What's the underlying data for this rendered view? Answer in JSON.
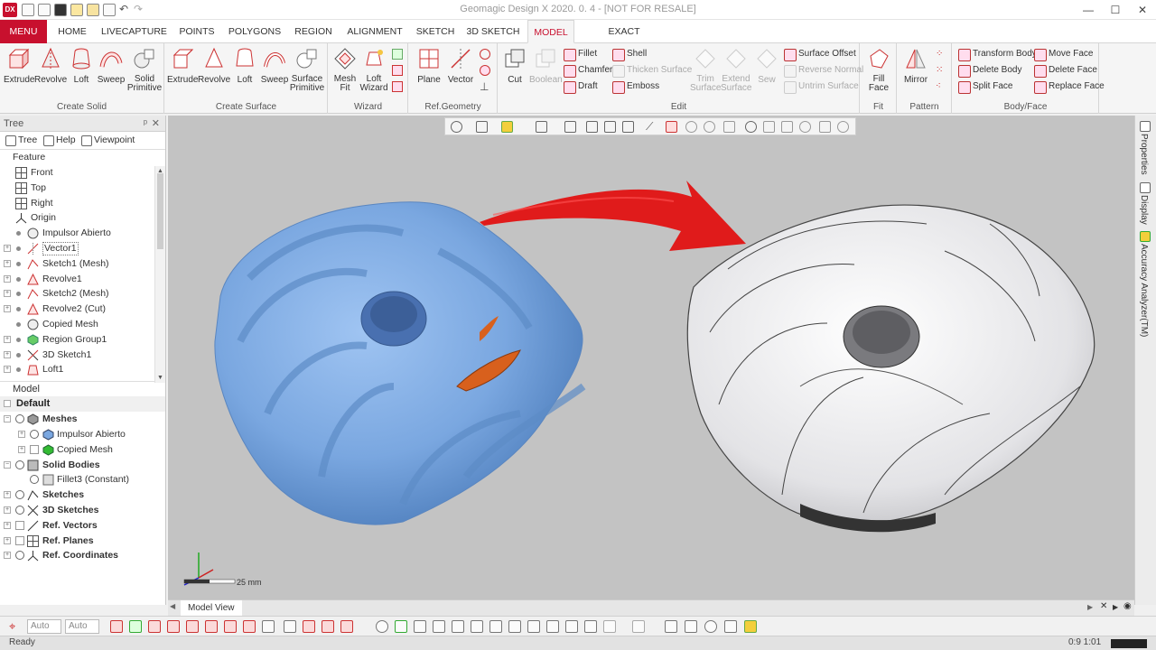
{
  "window": {
    "logo": "DX",
    "title": "Geomagic Design X 2020. 0. 4 - [NOT FOR RESALE]",
    "minimize": "—",
    "maximize": "☐",
    "close": "✕"
  },
  "tabs": [
    {
      "label": "MENU"
    },
    {
      "label": "HOME"
    },
    {
      "label": "LIVECAPTURE"
    },
    {
      "label": "POINTS"
    },
    {
      "label": "POLYGONS"
    },
    {
      "label": "REGION"
    },
    {
      "label": "ALIGNMENT"
    },
    {
      "label": "SKETCH"
    },
    {
      "label": "3D SKETCH"
    },
    {
      "label": "MODEL"
    },
    {
      "label": "EXACT SURFACING"
    }
  ],
  "ribbon": {
    "create_solid": {
      "label": "Create Solid",
      "buttons": [
        {
          "label": "Extrude"
        },
        {
          "label": "Revolve"
        },
        {
          "label": "Loft"
        },
        {
          "label": "Sweep"
        },
        {
          "label": "Solid Primitive"
        }
      ]
    },
    "create_surface": {
      "label": "Create Surface",
      "buttons": [
        {
          "label": "Extrude"
        },
        {
          "label": "Revolve"
        },
        {
          "label": "Loft"
        },
        {
          "label": "Sweep"
        },
        {
          "label": "Surface Primitive"
        }
      ]
    },
    "wizard": {
      "label": "Wizard",
      "buttons": [
        {
          "label": "Mesh Fit"
        },
        {
          "label": "Loft Wizard"
        }
      ]
    },
    "ref_geometry": {
      "label": "Ref.Geometry",
      "buttons": [
        {
          "label": "Plane"
        },
        {
          "label": "Vector"
        }
      ]
    },
    "edit": {
      "label": "Edit",
      "buttons": [
        {
          "label": "Cut"
        },
        {
          "label": "Boolean"
        },
        {
          "label": "Fillet"
        },
        {
          "label": "Chamfer"
        },
        {
          "label": "Draft"
        },
        {
          "label": "Shell"
        },
        {
          "label": "Thicken Surface"
        },
        {
          "label": "Emboss"
        },
        {
          "label": "Trim Surface"
        },
        {
          "label": "Extend Surface"
        },
        {
          "label": "Sew"
        },
        {
          "label": "Surface Offset"
        },
        {
          "label": "Reverse Normal"
        },
        {
          "label": "Untrim Surface"
        }
      ]
    },
    "fit": {
      "label": "Fit",
      "buttons": [
        {
          "label": "Fill Face"
        }
      ]
    },
    "pattern": {
      "label": "Pattern",
      "buttons": [
        {
          "label": "Mirror"
        }
      ]
    },
    "body_face": {
      "label": "Body/Face",
      "buttons": [
        {
          "label": "Transform Body"
        },
        {
          "label": "Delete Body"
        },
        {
          "label": "Split Face"
        },
        {
          "label": "Move Face"
        },
        {
          "label": "Delete Face"
        },
        {
          "label": "Replace Face"
        }
      ]
    }
  },
  "left_panel": {
    "title": "Tree",
    "pin": "ᵖ",
    "close": "✕",
    "tabs": [
      {
        "label": "Tree"
      },
      {
        "label": "Help"
      },
      {
        "label": "Viewpoint"
      }
    ],
    "feature_title": "Feature",
    "features": [
      {
        "label": "Front"
      },
      {
        "label": "Top"
      },
      {
        "label": "Right"
      },
      {
        "label": "Origin"
      },
      {
        "label": "Impulsor Abierto"
      },
      {
        "label": "Vector1"
      },
      {
        "label": "Sketch1 (Mesh)"
      },
      {
        "label": "Revolve1"
      },
      {
        "label": "Sketch2 (Mesh)"
      },
      {
        "label": "Revolve2 (Cut)"
      },
      {
        "label": "Copied Mesh"
      },
      {
        "label": "Region Group1"
      },
      {
        "label": "3D Sketch1"
      },
      {
        "label": "Loft1"
      }
    ],
    "model_title": "Model",
    "default_label": "Default",
    "model_items": [
      {
        "label": "Meshes"
      },
      {
        "label": "Impulsor Abierto"
      },
      {
        "label": "Copied Mesh"
      },
      {
        "label": "Solid Bodies"
      },
      {
        "label": "Fillet3 (Constant)"
      },
      {
        "label": "Sketches"
      },
      {
        "label": "3D Sketches"
      },
      {
        "label": "Ref. Vectors"
      },
      {
        "label": "Ref. Planes"
      },
      {
        "label": "Ref. Coordinates"
      }
    ]
  },
  "viewport": {
    "scale_label": "25 mm",
    "colors": {
      "background": "#c3c3c3",
      "mesh": "#7aa7e0",
      "arrow": "#e01b1b",
      "solid": "#e8e8ea"
    }
  },
  "right_dock": [
    {
      "label": "Properties"
    },
    {
      "label": "Display"
    },
    {
      "label": "Accuracy Analyzer(TM)"
    }
  ],
  "model_view_tab": "Model View",
  "bottom_toolbar": {
    "auto1": "Auto",
    "auto2": "Auto"
  },
  "status": {
    "text": "Ready",
    "right": "0:9 1:01"
  }
}
